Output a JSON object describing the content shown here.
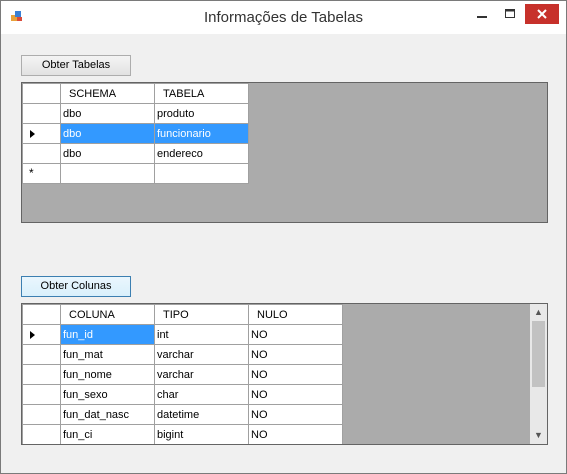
{
  "window": {
    "title": "Informações de Tabelas"
  },
  "buttons": {
    "obter_tabelas": "Obter Tabelas",
    "obter_colunas": "Obter Colunas"
  },
  "tables_grid": {
    "columns": [
      "SCHEMA",
      "TABELA"
    ],
    "rows": [
      [
        "dbo",
        "produto"
      ],
      [
        "dbo",
        "funcionario"
      ],
      [
        "dbo",
        "endereco"
      ]
    ],
    "selected_row": 1
  },
  "columns_grid": {
    "columns": [
      "COLUNA",
      "TIPO",
      "NULO"
    ],
    "rows": [
      [
        "fun_id",
        "int",
        "NO"
      ],
      [
        "fun_mat",
        "varchar",
        "NO"
      ],
      [
        "fun_nome",
        "varchar",
        "NO"
      ],
      [
        "fun_sexo",
        "char",
        "NO"
      ],
      [
        "fun_dat_nasc",
        "datetime",
        "NO"
      ],
      [
        "fun_ci",
        "bigint",
        "NO"
      ]
    ],
    "selected_row": 0
  },
  "colors": {
    "selection": "#3399ff",
    "grid_background": "#ababab",
    "close_button": "#c7312b"
  }
}
